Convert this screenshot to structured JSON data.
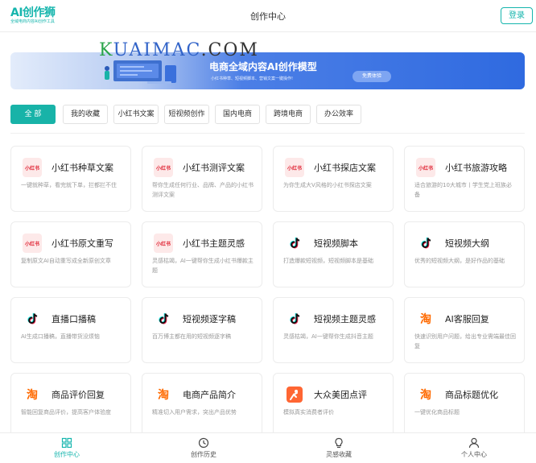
{
  "header": {
    "logo_text": "AI创作狮",
    "logo_subtitle": "全域电商内容AI创作工具",
    "title": "创作中心",
    "login_label": "登录"
  },
  "banner": {
    "watermark_green": "K",
    "watermark_blue": "UAIMAC",
    "watermark_rest": ".COM",
    "title": "电商全域内容AI创作模型",
    "subtitle": "小红书种草、短视频脚本、营销文案一键操作!",
    "button_label": "免费体验"
  },
  "tabs": [
    {
      "label": "全 部",
      "active": true
    },
    {
      "label": "我的收藏",
      "active": false
    },
    {
      "label": "小红书文案",
      "active": false
    },
    {
      "label": "短视频创作",
      "active": false
    },
    {
      "label": "国内电商",
      "active": false
    },
    {
      "label": "跨境电商",
      "active": false
    },
    {
      "label": "办公效率",
      "active": false
    }
  ],
  "cards": [
    {
      "icon": "xhs",
      "icon_text": "小红书",
      "title": "小红书种草文案",
      "desc": "一键就种草，看完就下单，拦都拦不住"
    },
    {
      "icon": "xhs",
      "icon_text": "小红书",
      "title": "小红书测评文案",
      "desc": "帮你生成任何行业、品牌、产品的小红书测评文案"
    },
    {
      "icon": "xhs",
      "icon_text": "小红书",
      "title": "小红书探店文案",
      "desc": "为你生成大V风格的小红书探店文案"
    },
    {
      "icon": "xhs",
      "icon_text": "小红书",
      "title": "小红书旅游攻略",
      "desc": "适合旅游的10大城市丨学生党上班族必备"
    },
    {
      "icon": "xhs",
      "icon_text": "小红书",
      "title": "小红书原文重写",
      "desc": "复制原文AI自动重写成全新原创文章"
    },
    {
      "icon": "xhs",
      "icon_text": "小红书",
      "title": "小红书主题灵感",
      "desc": "灵感枯竭，AI一键帮你生成小红书爆款主题"
    },
    {
      "icon": "dy",
      "icon_text": "",
      "title": "短视频脚本",
      "desc": "打造爆款短视频，短视频脚本是基础"
    },
    {
      "icon": "dy",
      "icon_text": "",
      "title": "短视频大纲",
      "desc": "优秀的短视频大纲，是好作品的基础"
    },
    {
      "icon": "dy",
      "icon_text": "",
      "title": "直播口播稿",
      "desc": "AI生成口播稿，直播带货没烦恼"
    },
    {
      "icon": "dy",
      "icon_text": "",
      "title": "短视频逐字稿",
      "desc": "百万博主都在用的短视频逐字稿"
    },
    {
      "icon": "dy",
      "icon_text": "",
      "title": "短视频主题灵感",
      "desc": "灵感枯竭，AI一键帮你生成抖音主题"
    },
    {
      "icon": "tb",
      "icon_text": "淘",
      "title": "AI客服回复",
      "desc": "快速识别用户问题，给出专业需端最佳回复"
    },
    {
      "icon": "tb",
      "icon_text": "淘",
      "title": "商品评价回复",
      "desc": "智能回复商品评价，提高客户体验度"
    },
    {
      "icon": "tb",
      "icon_text": "淘",
      "title": "电商产品简介",
      "desc": "精准切入用户需求，突出产品优势"
    },
    {
      "icon": "mt",
      "icon_text": "",
      "title": "大众美团点评",
      "desc": "模拟真实消费者评价"
    },
    {
      "icon": "tb",
      "icon_text": "淘",
      "title": "商品标题优化",
      "desc": "一键优化商品标题"
    }
  ],
  "bottom_nav": [
    {
      "label": "创作中心",
      "icon": "grid-icon",
      "active": true
    },
    {
      "label": "创作历史",
      "icon": "clock-icon",
      "active": false
    },
    {
      "label": "灵感收藏",
      "icon": "lightbulb-icon",
      "active": false
    },
    {
      "label": "个人中心",
      "icon": "user-icon",
      "active": false
    }
  ],
  "colors": {
    "accent": "#15b5ad",
    "xiaohongshu_red": "#e02434",
    "taobao_orange": "#ff6a00",
    "meituan_orange": "#ff6633"
  }
}
